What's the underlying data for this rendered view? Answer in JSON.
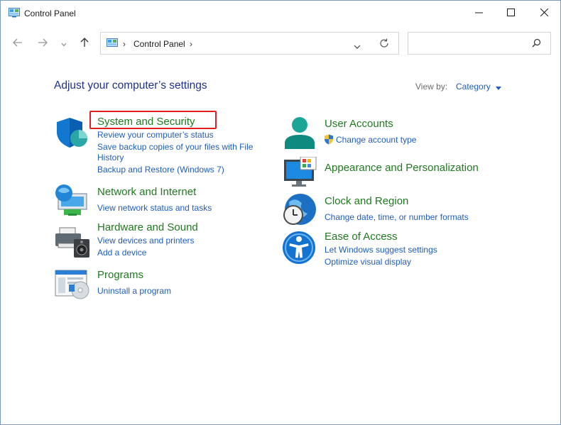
{
  "window": {
    "title": "Control Panel",
    "controls": {
      "minimize": "minimize",
      "maximize": "maximize",
      "close": "close"
    }
  },
  "address": {
    "crumbs": [
      "Control Panel"
    ],
    "search_placeholder": ""
  },
  "main": {
    "heading": "Adjust your computer’s settings",
    "view_by_label": "View by:",
    "view_by_value": "Category"
  },
  "categories_left": [
    {
      "title": "System and Security",
      "icon": "shield-icon",
      "links": [
        "Review your computer’s status",
        "Save backup copies of your files with File",
        "History",
        "Backup and Restore (Windows 7)"
      ]
    },
    {
      "title": "Network and Internet",
      "icon": "network-globe-icon",
      "links": [
        "View network status and tasks"
      ]
    },
    {
      "title": "Hardware and Sound",
      "icon": "printer-speaker-icon",
      "links": [
        "View devices and printers",
        "Add a device"
      ]
    },
    {
      "title": "Programs",
      "icon": "programs-disc-icon",
      "links": [
        "Uninstall a program"
      ]
    }
  ],
  "categories_right": [
    {
      "title": "User Accounts",
      "icon": "user-icon",
      "links": [
        "Change account type"
      ]
    },
    {
      "title": "Appearance and Personalization",
      "icon": "monitor-palette-icon",
      "links": []
    },
    {
      "title": "Clock and Region",
      "icon": "clock-globe-icon",
      "links": [
        "Change date, time, or number formats"
      ]
    },
    {
      "title": "Ease of Access",
      "icon": "accessibility-icon",
      "links": [
        "Let Windows suggest settings",
        "Optimize visual display"
      ]
    }
  ],
  "colors": {
    "heading": "#1e3287",
    "category_title": "#1f7a1f",
    "link": "#1e5dbf",
    "highlight_box": "#e02020"
  }
}
